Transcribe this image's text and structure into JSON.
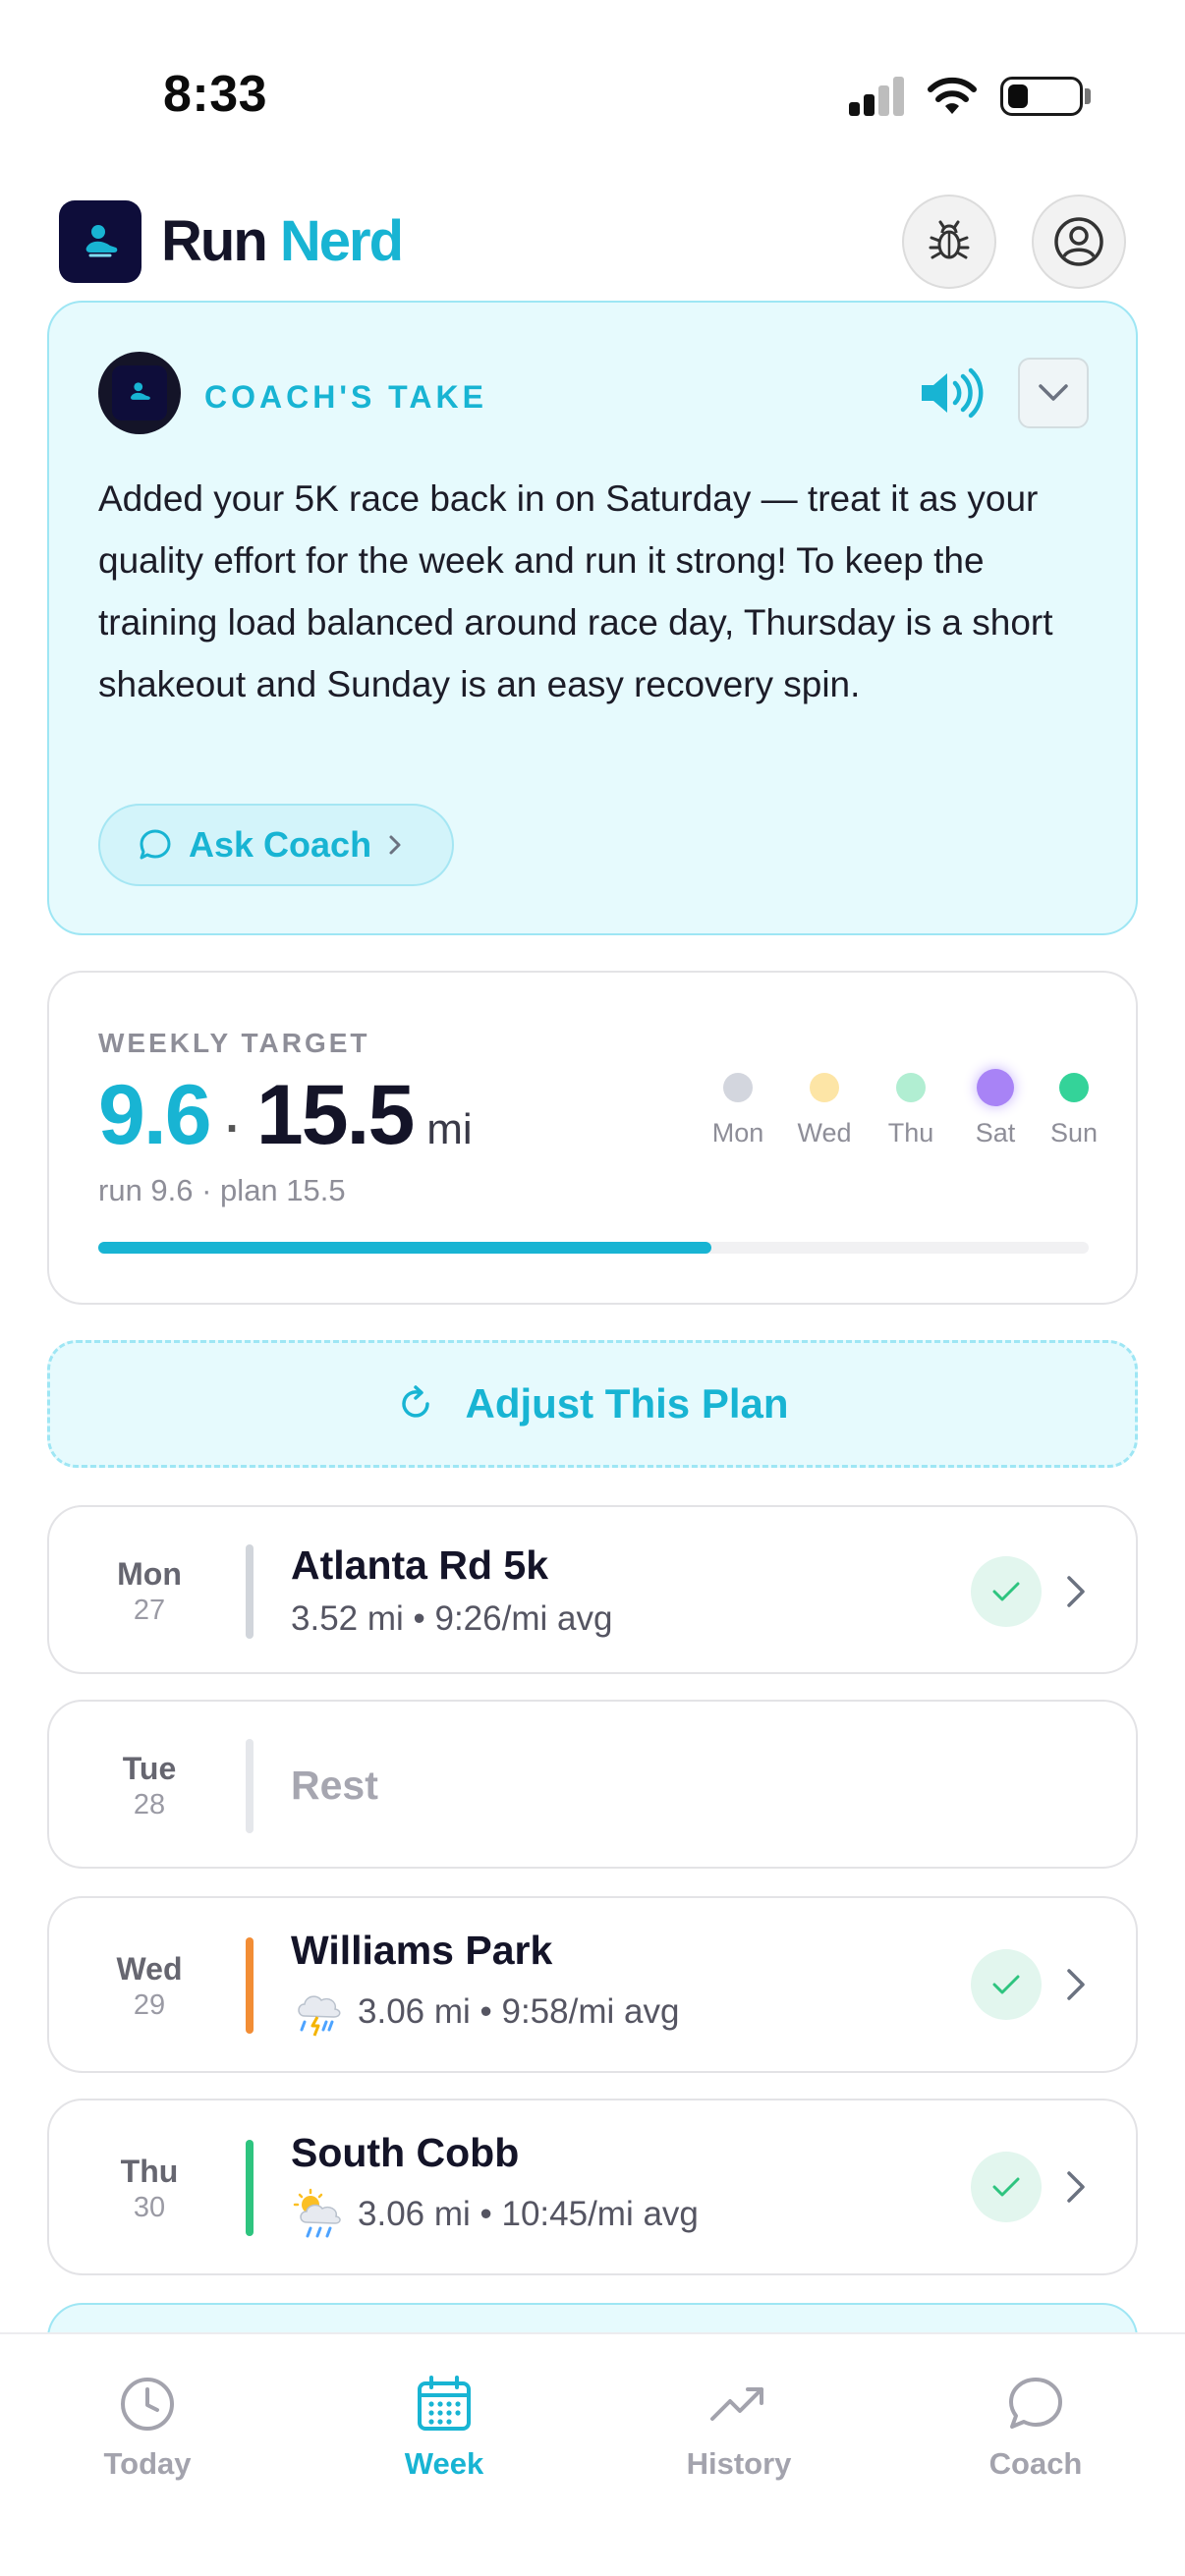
{
  "status_bar": {
    "time": "8:33"
  },
  "header": {
    "title_part1": "Run",
    "title_part2": "Nerd"
  },
  "coach_card": {
    "label": "COACH'S TAKE",
    "message": "Added your 5K race back in on Saturday — treat it as your quality effort for the week and run it strong! To keep the training load balanced around race day, Thursday is a short shakeout and Sunday is an easy recovery spin.",
    "ask_button": "Ask Coach"
  },
  "weekly_target": {
    "label": "WEEKLY TARGET",
    "run_value": "9.6",
    "separator": "·",
    "plan_value": "15.5",
    "unit": "mi",
    "subtitle": "run 9.6 · plan 15.5",
    "progress_fraction": 0.619,
    "days": [
      {
        "label": "Mon",
        "color": "#d3d6de"
      },
      {
        "label": "Wed",
        "color": "#fde5a6"
      },
      {
        "label": "Thu",
        "color": "#b1eed2"
      },
      {
        "label": "Sat",
        "color": "#a883f6"
      },
      {
        "label": "Sun",
        "color": "#34d399"
      }
    ]
  },
  "adjust_button": "Adjust This Plan",
  "days": [
    {
      "day": "Mon",
      "date": "27",
      "title": "Atlanta Rd 5k",
      "stats": "3.52 mi • 9:26/mi avg",
      "bar_color": "#d1d5db",
      "weather": "",
      "completed": true
    },
    {
      "day": "Tue",
      "date": "28",
      "title": "Rest",
      "stats": "",
      "bar_color": "#e5e7eb",
      "weather": "",
      "completed": false
    },
    {
      "day": "Wed",
      "date": "29",
      "title": "Williams Park",
      "stats": "3.06 mi • 9:58/mi avg",
      "bar_color": "#f28d35",
      "weather": "storm-icon",
      "completed": true
    },
    {
      "day": "Thu",
      "date": "30",
      "title": "South Cobb",
      "stats": "3.06 mi • 10:45/mi avg",
      "bar_color": "#2ec47f",
      "weather": "sun-rain-icon",
      "completed": true
    }
  ],
  "tabs": [
    {
      "label": "Today",
      "icon": "clock-icon",
      "active": false
    },
    {
      "label": "Week",
      "icon": "calendar-icon",
      "active": true
    },
    {
      "label": "History",
      "icon": "trend-icon",
      "active": false
    },
    {
      "label": "Coach",
      "icon": "chat-bubble-icon",
      "active": false
    }
  ],
  "colors": {
    "accent": "#18b4d3",
    "navy": "#0e0d3a",
    "success": "#2ec47f"
  }
}
